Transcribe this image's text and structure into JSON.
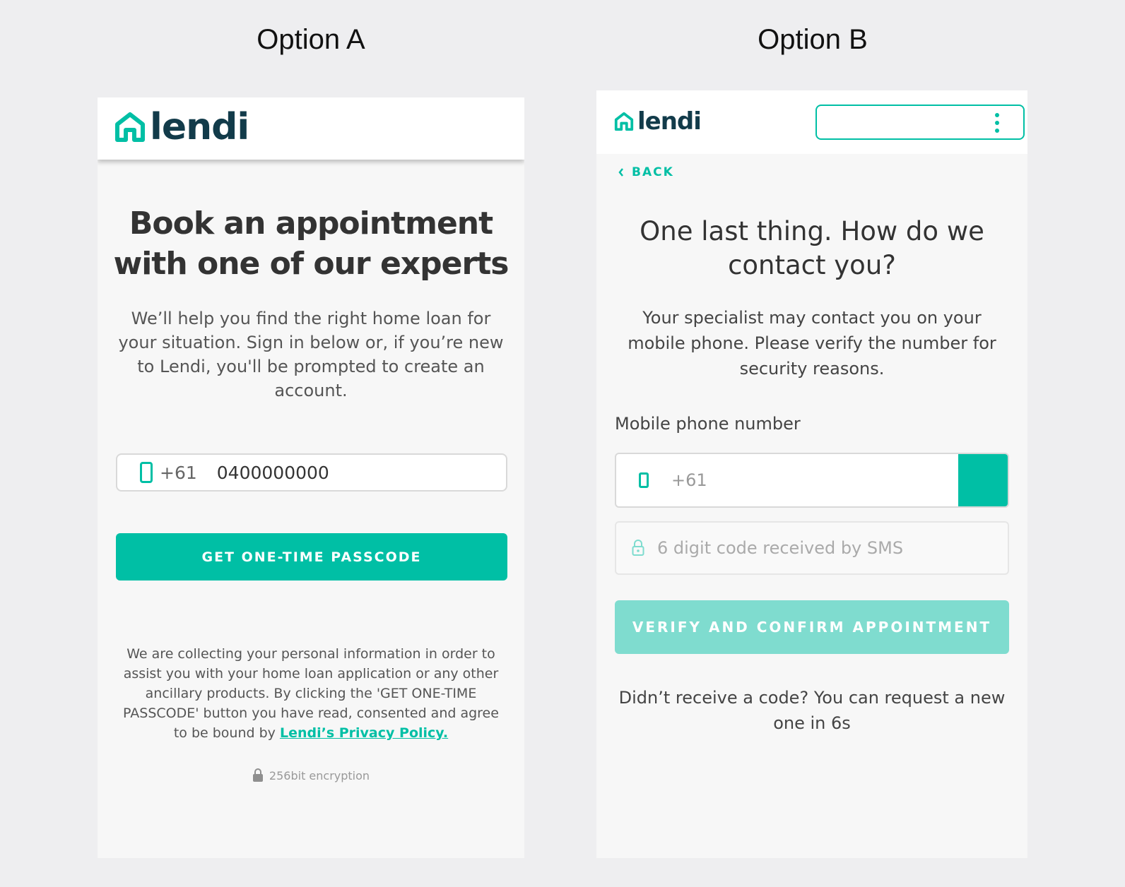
{
  "optionA": {
    "title": "Option A",
    "logo": "lendi",
    "heading": "Book an appointment with one of our experts",
    "description": "We’ll help you find the right home loan for your situation. Sign in below or, if you’re new to Lendi, you'll be prompted to create an account.",
    "phone": {
      "prefix": "+61",
      "value": "0400000000"
    },
    "button": "GET ONE-TIME PASSCODE",
    "consent": "We are collecting your personal information in order to assist you with your home loan application or any other ancillary products. By clicking the 'GET ONE-TIME PASSCODE' button you have read, consented and agree to be bound by",
    "privacy_link": "Lendi’s Privacy Policy.",
    "encryption": "256bit encryption"
  },
  "optionB": {
    "title": "Option B",
    "logo": "lendi",
    "back": "BACK",
    "heading": "One last thing. How do we contact you?",
    "description": "Your specialist may contact you on your mobile phone. Please verify the number for security reasons.",
    "mobile_label": "Mobile phone number",
    "phone_prefix": "+61",
    "code_placeholder": "6 digit code received by SMS",
    "button": "VERIFY AND CONFIRM APPOINTMENT",
    "resend": "Didn’t receive a code? You can request a new one in 6s"
  },
  "colors": {
    "brand": "#00bfa5",
    "brand_light": "#7fdccf",
    "text_dark": "#333333"
  },
  "icons": [
    "home-icon",
    "phone-icon",
    "lock-icon",
    "chevron-left-icon",
    "kebab-menu-icon"
  ]
}
